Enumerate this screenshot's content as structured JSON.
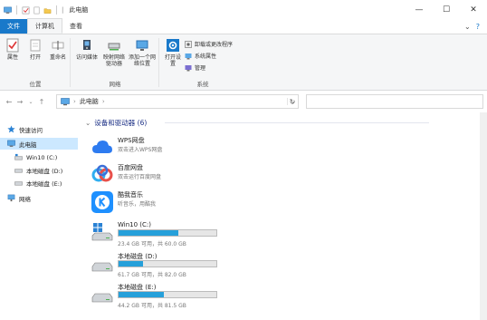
{
  "window": {
    "title": "此电脑",
    "controls": {
      "minimize": "—",
      "maximize": "☐",
      "close": "✕"
    }
  },
  "ribbon": {
    "tabs": [
      {
        "label": "文件"
      },
      {
        "label": "计算机"
      },
      {
        "label": "查看"
      }
    ],
    "groups": {
      "location": {
        "label": "位置",
        "buttons": [
          {
            "label": "属性",
            "icon": "checkmark-properties-icon"
          },
          {
            "label": "打开",
            "icon": "open-icon"
          },
          {
            "label": "重命名",
            "icon": "rename-icon"
          }
        ]
      },
      "network": {
        "label": "网络",
        "buttons": [
          {
            "label": "访问媒体",
            "icon": "media-access-icon"
          },
          {
            "label": "映射网络驱动器",
            "icon": "map-network-drive-icon"
          },
          {
            "label": "添加一个网络位置",
            "icon": "add-network-location-icon"
          }
        ]
      },
      "system": {
        "label": "系统",
        "open_settings": "打开设置",
        "small_buttons": [
          {
            "label": "卸载或更改程序",
            "icon": "uninstall-icon"
          },
          {
            "label": "系统属性",
            "icon": "system-properties-icon"
          },
          {
            "label": "管理",
            "icon": "manage-icon"
          }
        ]
      }
    }
  },
  "address": {
    "path": "此电脑",
    "separator": "›"
  },
  "nav_pane": {
    "items": [
      {
        "label": "快速访问",
        "icon": "star-icon"
      },
      {
        "label": "此电脑",
        "icon": "computer-icon",
        "selected": true
      },
      {
        "label": "Win10 (C:)",
        "icon": "drive-c-icon"
      },
      {
        "label": "本地磁盘 (D:)",
        "icon": "drive-icon"
      },
      {
        "label": "本地磁盘 (E:)",
        "icon": "drive-icon"
      },
      {
        "label": "网络",
        "icon": "network-icon"
      }
    ]
  },
  "content": {
    "section_title": "设备和驱动器 (6)",
    "apps": [
      {
        "name": "WPS网盘",
        "sub": "双击进入WPS网盘",
        "icon": "wps-cloud-icon",
        "color": "#2d7bf0"
      },
      {
        "name": "百度网盘",
        "sub": "双击运行百度网盘",
        "icon": "baidu-netdisk-icon",
        "color": "#2faef0"
      },
      {
        "name": "酷我音乐",
        "sub": "听音乐，用酷我",
        "icon": "kuwo-music-icon",
        "color": "#1e90ff"
      }
    ],
    "drives": [
      {
        "name": "Win10 (C:)",
        "free_text": "23.4 GB 可用，共 60.0 GB",
        "used_fraction": 0.61,
        "icon": "windows-drive-icon"
      },
      {
        "name": "本地磁盘 (D:)",
        "free_text": "61.7 GB 可用，共 82.0 GB",
        "used_fraction": 0.25,
        "icon": "hard-drive-icon"
      },
      {
        "name": "本地磁盘 (E:)",
        "free_text": "44.2 GB 可用，共 81.5 GB",
        "used_fraction": 0.46,
        "icon": "hard-drive-icon"
      }
    ],
    "bar_fill_color": "#26a0da"
  }
}
